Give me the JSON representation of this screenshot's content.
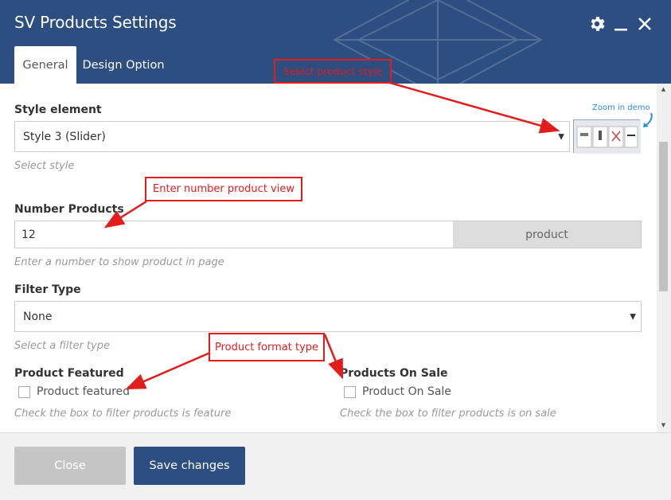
{
  "window": {
    "title": "SV Products Settings",
    "icons": [
      "gear-icon",
      "minimize-icon",
      "close-icon"
    ]
  },
  "tabs": [
    {
      "label": "General",
      "active": true
    },
    {
      "label": "Design Option",
      "active": false
    }
  ],
  "style_element": {
    "label": "Style element",
    "value": "Style 3 (Slider)",
    "hint": "Select style",
    "zoom_label": "Zoom in demo"
  },
  "number_products": {
    "label": "Number Products",
    "value": "12",
    "addon": "product",
    "hint": "Enter a number to show product in page"
  },
  "filter_type": {
    "label": "Filter Type",
    "value": "None",
    "hint": "Select a filter type"
  },
  "product_featured": {
    "label": "Product Featured",
    "checkbox_label": "Product featured",
    "checked": false,
    "hint": "Check the box to filter products is feature"
  },
  "products_on_sale": {
    "label": "Products On Sale",
    "checkbox_label": "Product On Sale",
    "checked": false,
    "hint": "Check the box to filter products is on sale"
  },
  "footer": {
    "close_label": "Close",
    "save_label": "Save changes"
  },
  "annotations": {
    "select_style": "Select product style",
    "number_view": "Enter number product view",
    "format_type": "Product format type"
  },
  "colors": {
    "header": "#2d4e80",
    "annotation": "#e31c1c",
    "save_button": "#2d4e80",
    "close_button": "#c5c5c5"
  }
}
